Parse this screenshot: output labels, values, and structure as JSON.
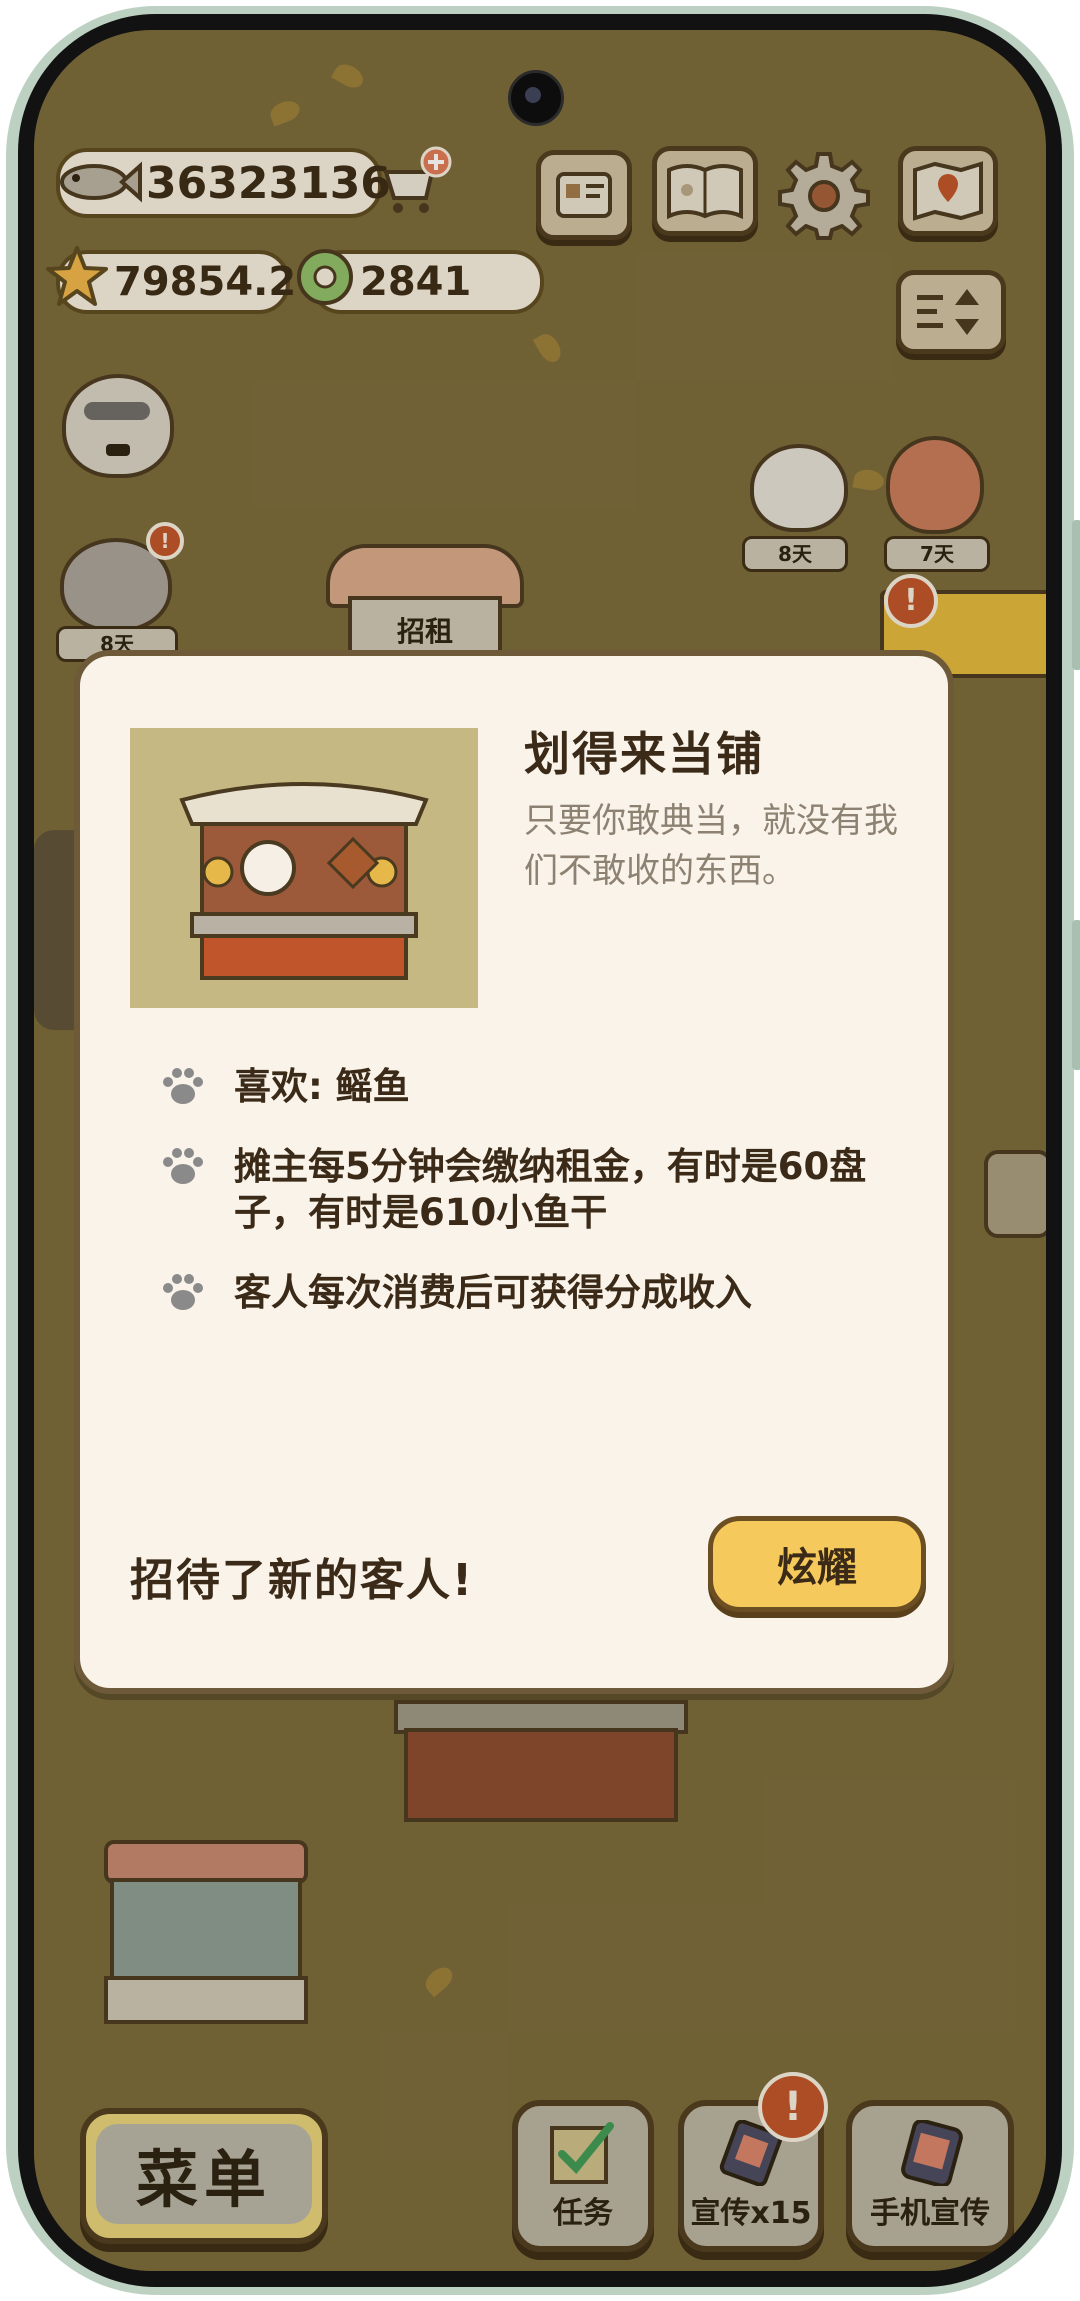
{
  "currency": {
    "fish": "36323136",
    "stars": "79854.2",
    "rings": "2841"
  },
  "top_icons": [
    "card-icon",
    "book-icon",
    "gear-icon",
    "map-icon"
  ],
  "sort_icon": "sort-icon",
  "shop_sign": "招租",
  "day_tags": [
    "8天",
    "8天",
    "7天"
  ],
  "dialog": {
    "title": "划得来当铺",
    "subtitle": "只要你敢典当，就没有我们不敢收的东西。",
    "features": [
      "喜欢: 鳐鱼",
      "摊主每5分钟会缴纳租金，有时是60盘子，有时是610小鱼干",
      "客人每次消费后可获得分成收入"
    ],
    "footer": "招待了新的客人!",
    "show_button": "炫耀"
  },
  "bottom": {
    "menu": "菜单",
    "task": "任务",
    "promo": "宣传x15",
    "phone_promo": "手机宣传"
  },
  "colors": {
    "background": "#7a6a3c",
    "dialog": "#f9f3ea",
    "button": "#f5c95b",
    "alert": "#c0542a"
  }
}
